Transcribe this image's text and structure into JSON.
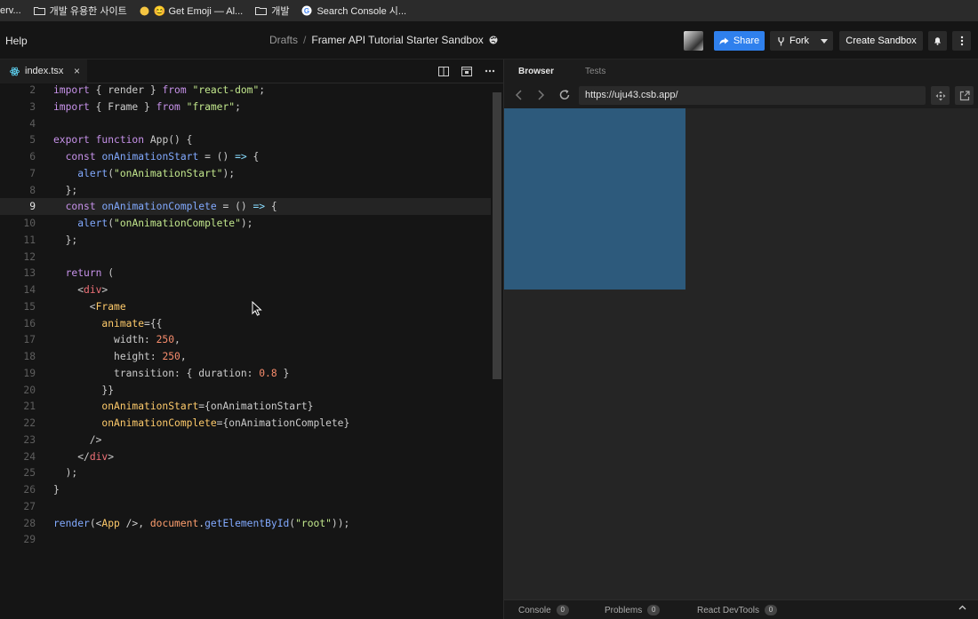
{
  "bookmarks": [
    {
      "label": "erv...",
      "icon": "none"
    },
    {
      "label": "개발 유용한 사이트",
      "icon": "folder-icon"
    },
    {
      "label": "😊 Get Emoji — Al...",
      "icon": "emoji-icon"
    },
    {
      "label": "개발",
      "icon": "folder-icon"
    },
    {
      "label": "Search Console 시...",
      "icon": "google-icon"
    }
  ],
  "header": {
    "help_label": "Help",
    "breadcrumb_root": "Drafts",
    "breadcrumb_sep": "/",
    "sandbox_title": "Framer API Tutorial Starter Sandbox",
    "share_label": "Share",
    "fork_label": "Fork",
    "create_label": "Create Sandbox"
  },
  "editor": {
    "tab_label": "index.tsx",
    "close_glyph": "×",
    "active_line": 9
  },
  "code_lines": [
    {
      "n": 2,
      "text": "import { render } from \"react-dom\";"
    },
    {
      "n": 3,
      "text": "import { Frame } from \"framer\";"
    },
    {
      "n": 4,
      "text": ""
    },
    {
      "n": 5,
      "text": "export function App() {"
    },
    {
      "n": 6,
      "text": "  const onAnimationStart = () => {"
    },
    {
      "n": 7,
      "text": "    alert(\"onAnimationStart\");"
    },
    {
      "n": 8,
      "text": "  };"
    },
    {
      "n": 9,
      "text": "  const onAnimationComplete = () => {"
    },
    {
      "n": 10,
      "text": "    alert(\"onAnimationComplete\");"
    },
    {
      "n": 11,
      "text": "  };"
    },
    {
      "n": 12,
      "text": ""
    },
    {
      "n": 13,
      "text": "  return ("
    },
    {
      "n": 14,
      "text": "    <div>"
    },
    {
      "n": 15,
      "text": "      <Frame"
    },
    {
      "n": 16,
      "text": "        animate={{"
    },
    {
      "n": 17,
      "text": "          width: 250,"
    },
    {
      "n": 18,
      "text": "          height: 250,"
    },
    {
      "n": 19,
      "text": "          transition: { duration: 0.8 }"
    },
    {
      "n": 20,
      "text": "        }}"
    },
    {
      "n": 21,
      "text": "        onAnimationStart={onAnimationStart}"
    },
    {
      "n": 22,
      "text": "        onAnimationComplete={onAnimationComplete}"
    },
    {
      "n": 23,
      "text": "      />"
    },
    {
      "n": 24,
      "text": "    </div>"
    },
    {
      "n": 25,
      "text": "  );"
    },
    {
      "n": 26,
      "text": "}"
    },
    {
      "n": 27,
      "text": ""
    },
    {
      "n": 28,
      "text": "render(<App />, document.getElementById(\"root\"));"
    },
    {
      "n": 29,
      "text": ""
    }
  ],
  "browser": {
    "tabs": [
      "Browser",
      "Tests"
    ],
    "url": "https://uju43.csb.app/",
    "frame_color": "#2d5a7c"
  },
  "console_bar": [
    {
      "label": "Console",
      "count": "0"
    },
    {
      "label": "Problems",
      "count": "0"
    },
    {
      "label": "React DevTools",
      "count": "0"
    }
  ],
  "colors": {
    "accent": "#2f80ed",
    "background": "#151515"
  }
}
